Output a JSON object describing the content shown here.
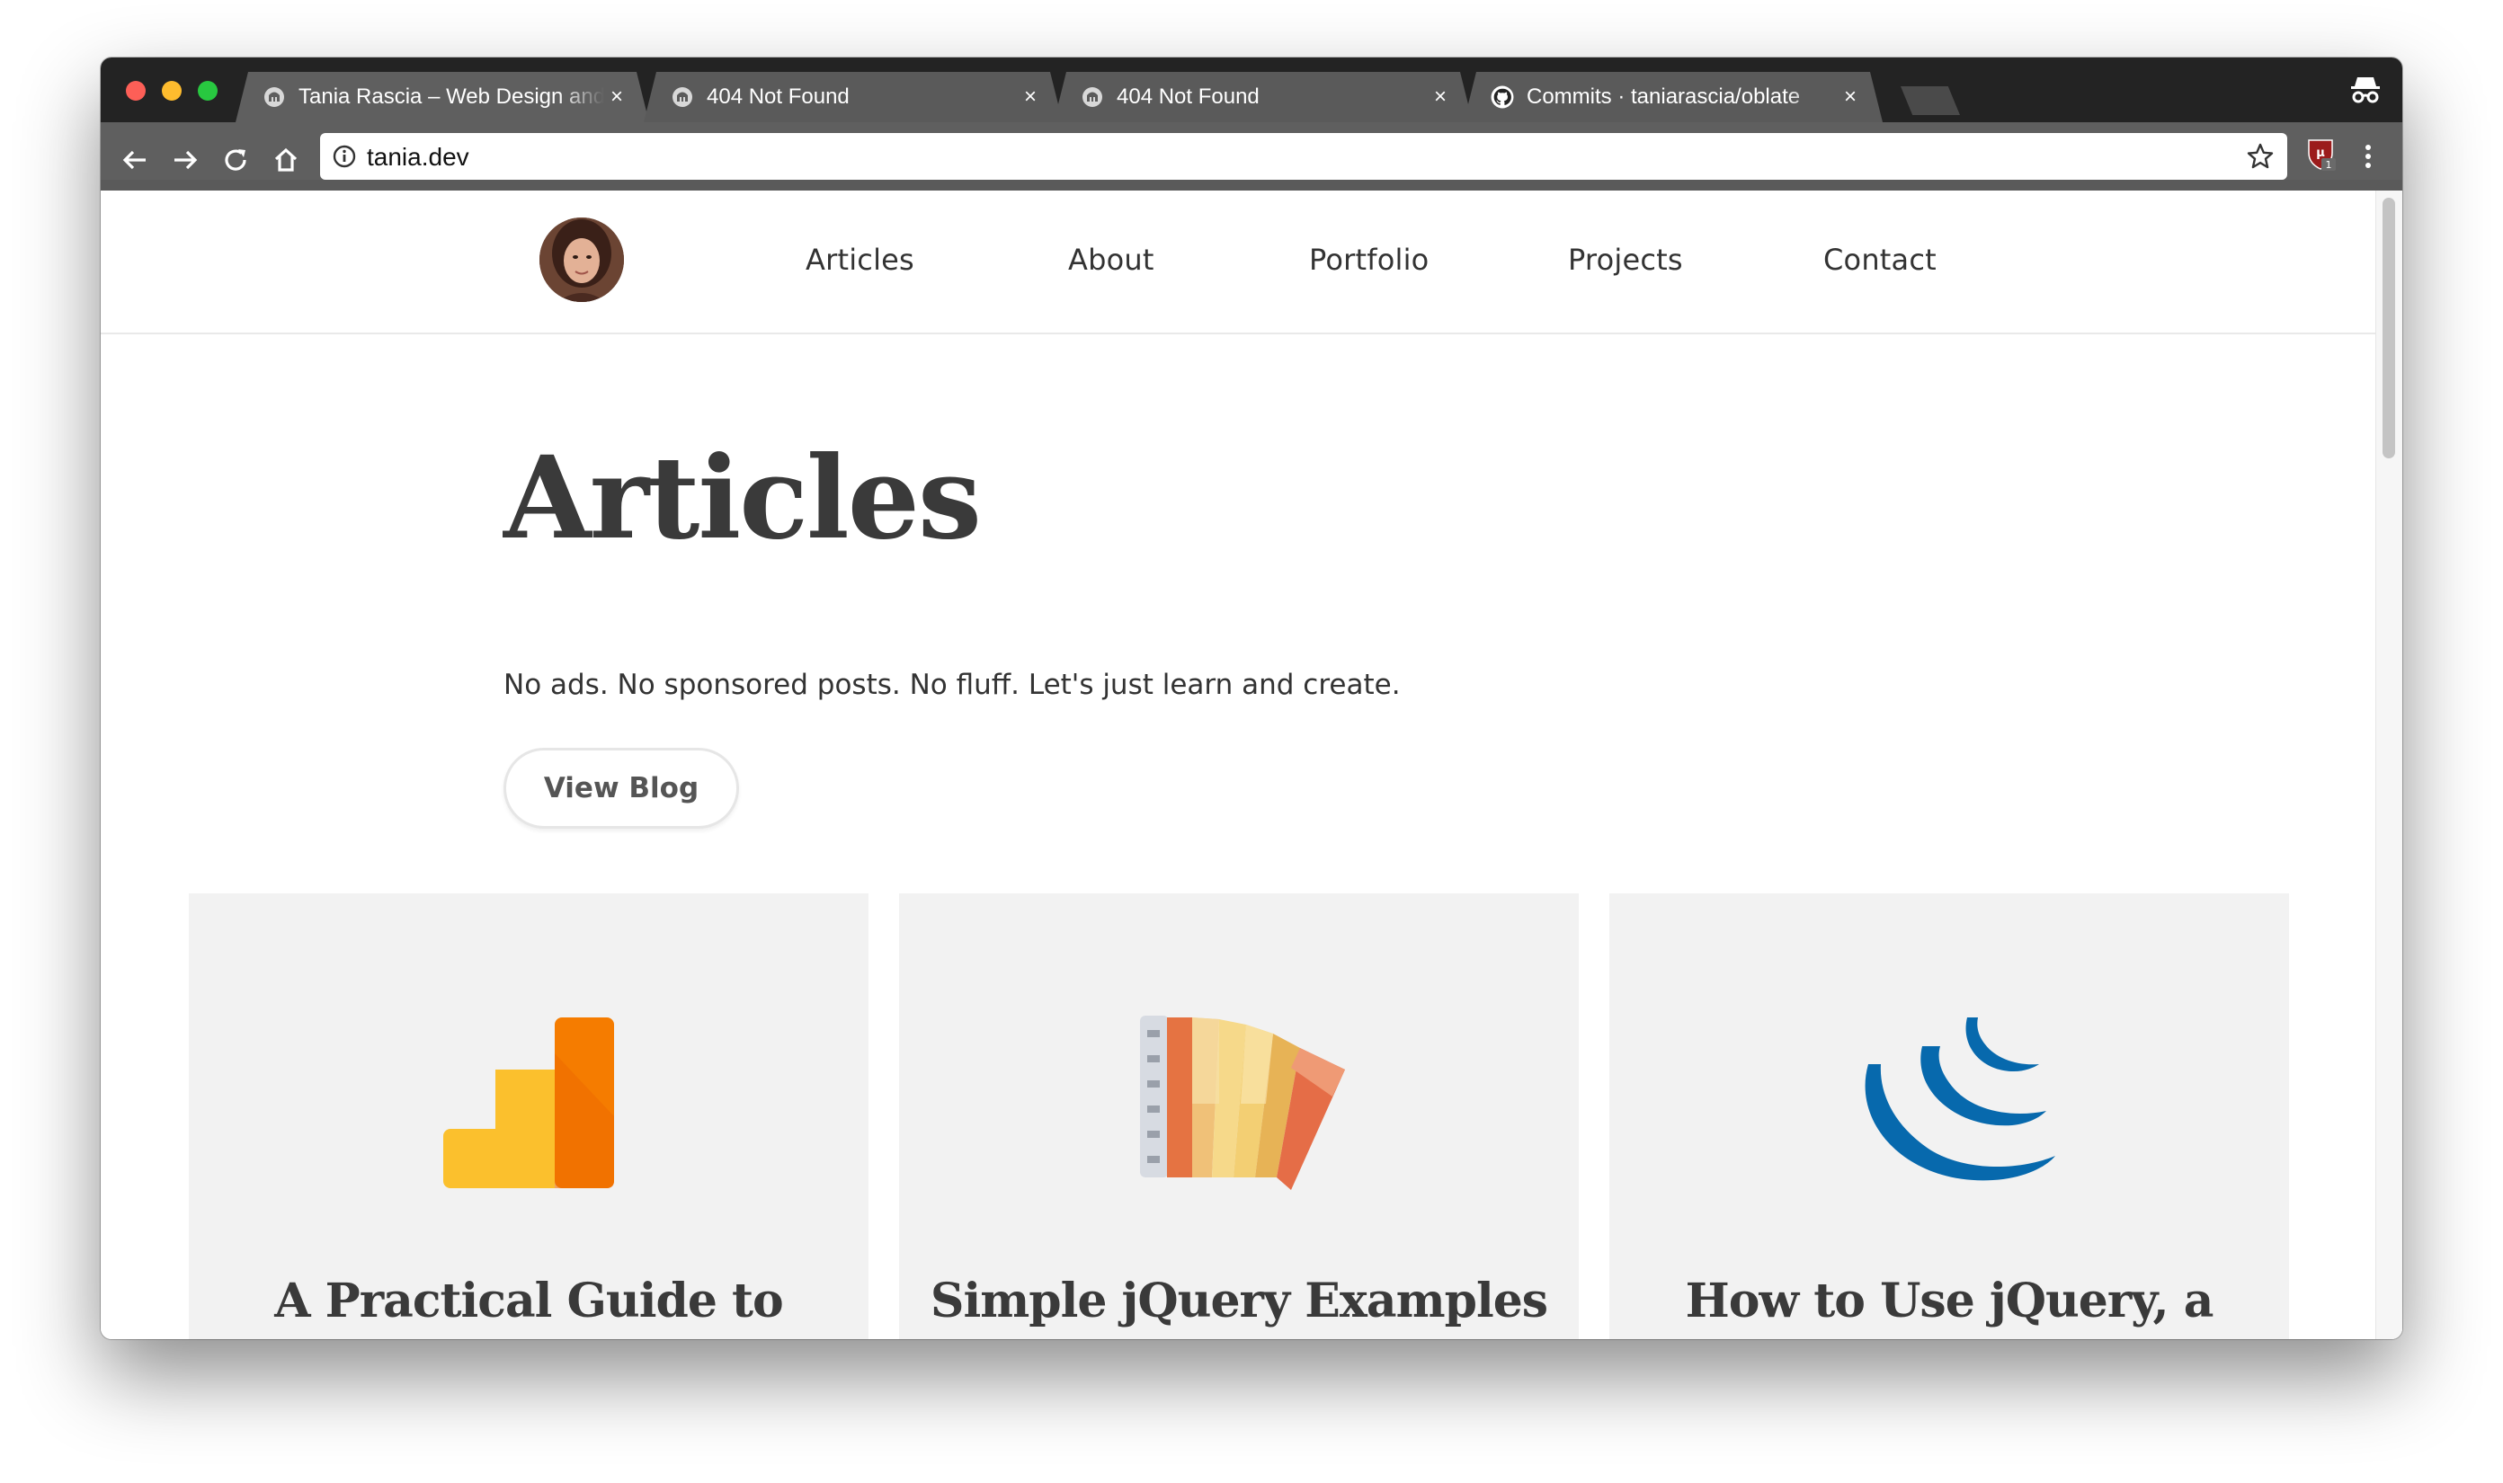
{
  "browser": {
    "tabs": [
      {
        "title": "Tania Rascia – Web Design and Development",
        "favicon": "site-favicon",
        "active": true
      },
      {
        "title": "404 Not Found",
        "favicon": "site-favicon",
        "active": false
      },
      {
        "title": "404 Not Found",
        "favicon": "site-favicon",
        "active": false
      },
      {
        "title": "Commits · taniarascia/oblate",
        "favicon": "github-icon",
        "active": false
      }
    ],
    "url": "tania.dev",
    "extension_badge": "1",
    "colors": {
      "tabstrip": "#232323",
      "toolbar": "#5f5f5f"
    }
  },
  "site": {
    "nav": [
      "Articles",
      "About",
      "Portfolio",
      "Projects",
      "Contact"
    ],
    "page_title": "Articles",
    "tagline": "No ads. No sponsored posts. No fluff. Let's just learn and create.",
    "cta_label": "View Blog",
    "cards": [
      {
        "title": "A Practical Guide to Search Engine",
        "icon": "google-analytics-icon"
      },
      {
        "title": "Simple jQuery Examples with Code and Demos",
        "icon": "color-swatch-fan-icon"
      },
      {
        "title": "How to Use jQuery, a JavaScript Library",
        "icon": "jquery-logo-icon"
      }
    ]
  }
}
